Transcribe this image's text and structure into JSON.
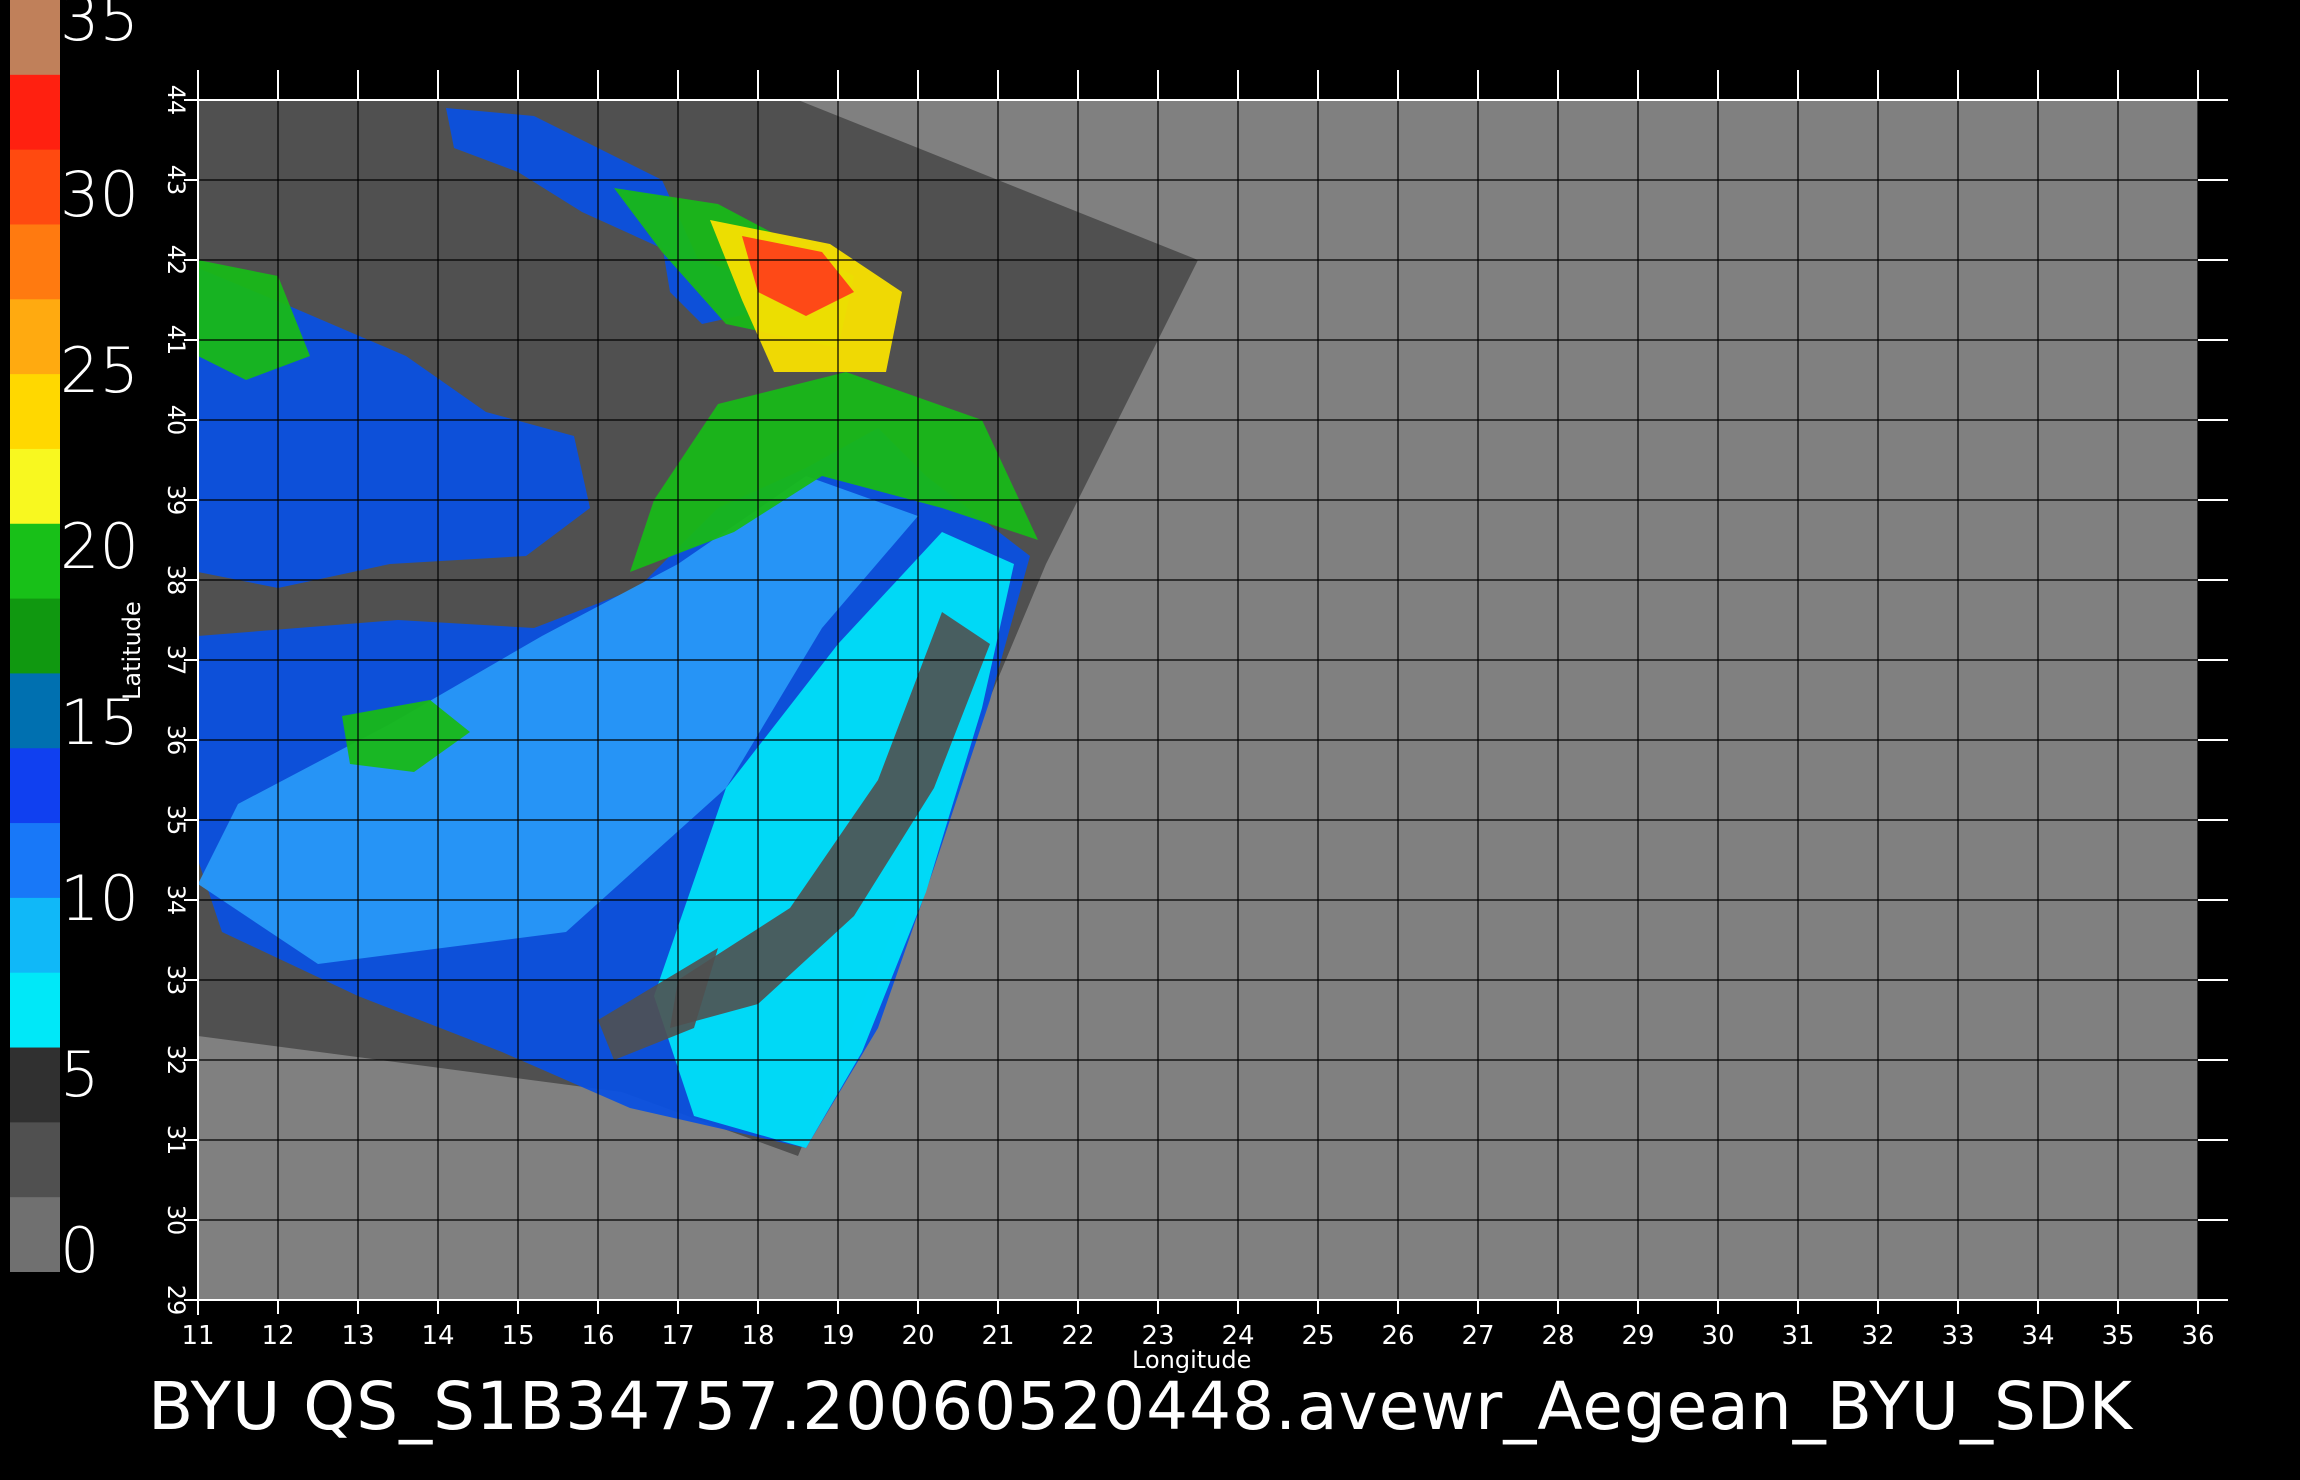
{
  "title": "BYU  QS_S1B34757.20060520448.avewr_Aegean_BYU_SDK",
  "colorbar": {
    "labels": [
      "35",
      "30",
      "25",
      "20",
      "15",
      "10",
      "5",
      "0"
    ],
    "segments": [
      "#c0805a",
      "#ff2010",
      "#ff4a10",
      "#ff7a10",
      "#ffaa10",
      "#ffd800",
      "#f8f820",
      "#18c018",
      "#109810",
      "#0070b0",
      "#1040f0",
      "#1878f8",
      "#10b8f8",
      "#00e8f8",
      "#303030",
      "#505050",
      "#707070"
    ]
  },
  "map": {
    "x_axis_label": "Longitude",
    "y_axis_label": "Latitude",
    "lon_ticks": [
      "11",
      "12",
      "13",
      "14",
      "15",
      "16",
      "17",
      "18",
      "19",
      "20",
      "21",
      "22",
      "23",
      "24",
      "25",
      "26",
      "27",
      "28",
      "29",
      "30",
      "31",
      "32",
      "33",
      "34",
      "35",
      "36"
    ],
    "lat_ticks": [
      "29",
      "30",
      "31",
      "32",
      "33",
      "34",
      "35",
      "36",
      "37",
      "38",
      "39",
      "40",
      "41",
      "42",
      "43",
      "44"
    ],
    "colors": {
      "no_data": "#808080",
      "swath_land": "#505050",
      "grid": "#000000",
      "calm": "#0a50e0",
      "moderate": "#2898f8",
      "light": "#00e0f8",
      "fresh": "#18b818",
      "strong": "#f8e000",
      "gale": "#ff4018"
    }
  }
}
